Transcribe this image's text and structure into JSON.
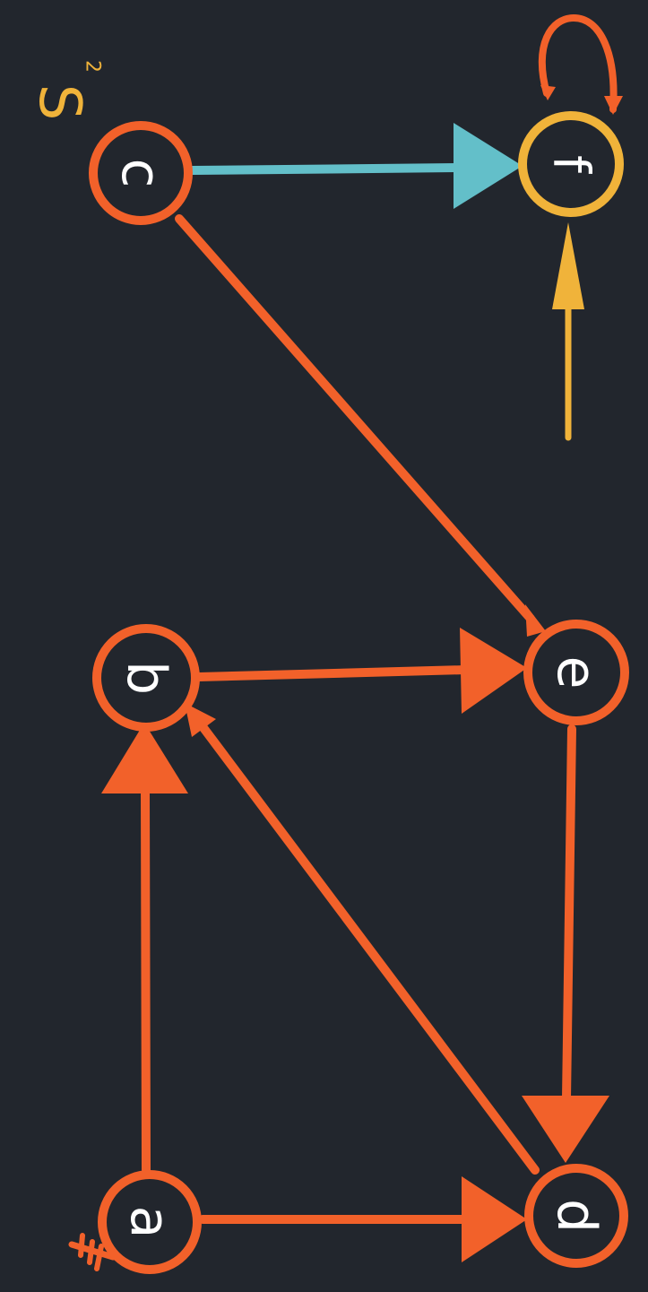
{
  "colors": {
    "background": "#22262d",
    "primary": "#f2612a",
    "highlight": "#f0b33a",
    "accent": "#63bfc9",
    "text": "#ffffff"
  },
  "annotation": {
    "set_letter": "S",
    "set_subscript": "2"
  },
  "nodes": {
    "a": "a",
    "b": "b",
    "c": "c",
    "d": "d",
    "e": "e",
    "f": "f"
  },
  "edges": [
    {
      "from": "a",
      "to": "b"
    },
    {
      "from": "a",
      "to": "d"
    },
    {
      "from": "d",
      "to": "b"
    },
    {
      "from": "b",
      "to": "e"
    },
    {
      "from": "e",
      "to": "d"
    },
    {
      "from": "c",
      "to": "e"
    },
    {
      "from": "c",
      "to": "f",
      "highlight": true
    },
    {
      "from": "f",
      "to": "f",
      "self_loop": true
    },
    {
      "to": "f",
      "incoming": true
    }
  ]
}
